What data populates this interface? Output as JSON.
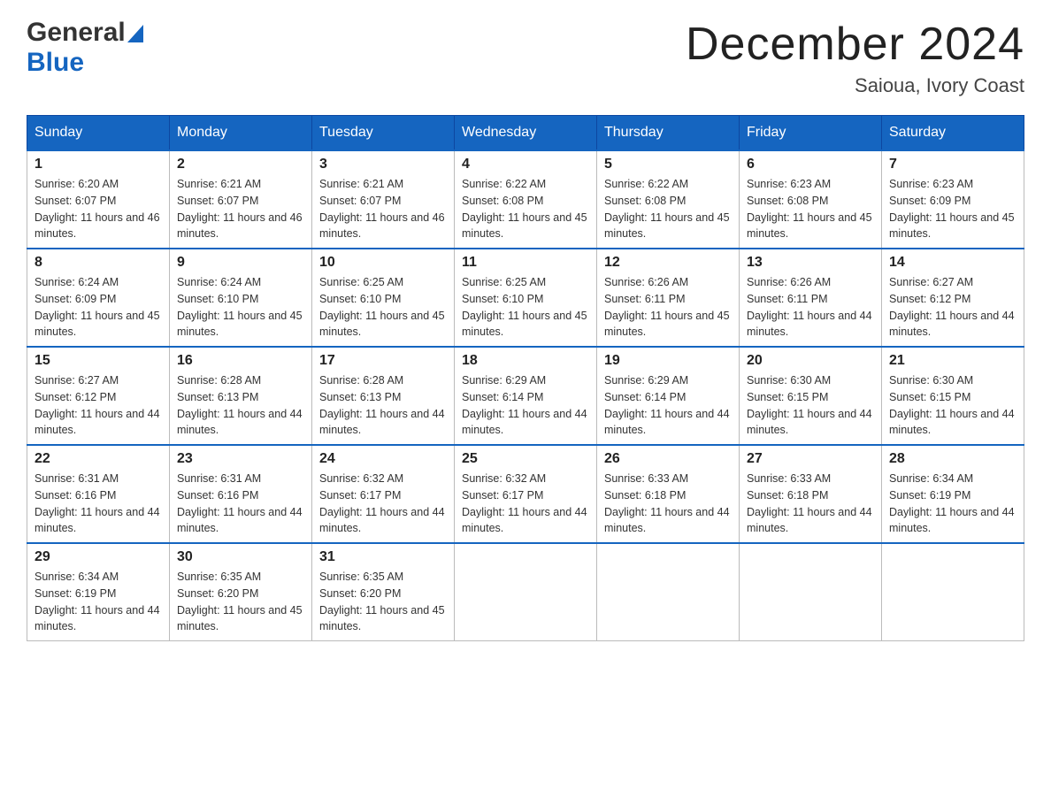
{
  "header": {
    "logo_general": "General",
    "logo_blue": "Blue",
    "month_title": "December 2024",
    "location": "Saioua, Ivory Coast"
  },
  "days_of_week": [
    "Sunday",
    "Monday",
    "Tuesday",
    "Wednesday",
    "Thursday",
    "Friday",
    "Saturday"
  ],
  "weeks": [
    [
      {
        "day": "1",
        "sunrise": "Sunrise: 6:20 AM",
        "sunset": "Sunset: 6:07 PM",
        "daylight": "Daylight: 11 hours and 46 minutes."
      },
      {
        "day": "2",
        "sunrise": "Sunrise: 6:21 AM",
        "sunset": "Sunset: 6:07 PM",
        "daylight": "Daylight: 11 hours and 46 minutes."
      },
      {
        "day": "3",
        "sunrise": "Sunrise: 6:21 AM",
        "sunset": "Sunset: 6:07 PM",
        "daylight": "Daylight: 11 hours and 46 minutes."
      },
      {
        "day": "4",
        "sunrise": "Sunrise: 6:22 AM",
        "sunset": "Sunset: 6:08 PM",
        "daylight": "Daylight: 11 hours and 45 minutes."
      },
      {
        "day": "5",
        "sunrise": "Sunrise: 6:22 AM",
        "sunset": "Sunset: 6:08 PM",
        "daylight": "Daylight: 11 hours and 45 minutes."
      },
      {
        "day": "6",
        "sunrise": "Sunrise: 6:23 AM",
        "sunset": "Sunset: 6:08 PM",
        "daylight": "Daylight: 11 hours and 45 minutes."
      },
      {
        "day": "7",
        "sunrise": "Sunrise: 6:23 AM",
        "sunset": "Sunset: 6:09 PM",
        "daylight": "Daylight: 11 hours and 45 minutes."
      }
    ],
    [
      {
        "day": "8",
        "sunrise": "Sunrise: 6:24 AM",
        "sunset": "Sunset: 6:09 PM",
        "daylight": "Daylight: 11 hours and 45 minutes."
      },
      {
        "day": "9",
        "sunrise": "Sunrise: 6:24 AM",
        "sunset": "Sunset: 6:10 PM",
        "daylight": "Daylight: 11 hours and 45 minutes."
      },
      {
        "day": "10",
        "sunrise": "Sunrise: 6:25 AM",
        "sunset": "Sunset: 6:10 PM",
        "daylight": "Daylight: 11 hours and 45 minutes."
      },
      {
        "day": "11",
        "sunrise": "Sunrise: 6:25 AM",
        "sunset": "Sunset: 6:10 PM",
        "daylight": "Daylight: 11 hours and 45 minutes."
      },
      {
        "day": "12",
        "sunrise": "Sunrise: 6:26 AM",
        "sunset": "Sunset: 6:11 PM",
        "daylight": "Daylight: 11 hours and 45 minutes."
      },
      {
        "day": "13",
        "sunrise": "Sunrise: 6:26 AM",
        "sunset": "Sunset: 6:11 PM",
        "daylight": "Daylight: 11 hours and 44 minutes."
      },
      {
        "day": "14",
        "sunrise": "Sunrise: 6:27 AM",
        "sunset": "Sunset: 6:12 PM",
        "daylight": "Daylight: 11 hours and 44 minutes."
      }
    ],
    [
      {
        "day": "15",
        "sunrise": "Sunrise: 6:27 AM",
        "sunset": "Sunset: 6:12 PM",
        "daylight": "Daylight: 11 hours and 44 minutes."
      },
      {
        "day": "16",
        "sunrise": "Sunrise: 6:28 AM",
        "sunset": "Sunset: 6:13 PM",
        "daylight": "Daylight: 11 hours and 44 minutes."
      },
      {
        "day": "17",
        "sunrise": "Sunrise: 6:28 AM",
        "sunset": "Sunset: 6:13 PM",
        "daylight": "Daylight: 11 hours and 44 minutes."
      },
      {
        "day": "18",
        "sunrise": "Sunrise: 6:29 AM",
        "sunset": "Sunset: 6:14 PM",
        "daylight": "Daylight: 11 hours and 44 minutes."
      },
      {
        "day": "19",
        "sunrise": "Sunrise: 6:29 AM",
        "sunset": "Sunset: 6:14 PM",
        "daylight": "Daylight: 11 hours and 44 minutes."
      },
      {
        "day": "20",
        "sunrise": "Sunrise: 6:30 AM",
        "sunset": "Sunset: 6:15 PM",
        "daylight": "Daylight: 11 hours and 44 minutes."
      },
      {
        "day": "21",
        "sunrise": "Sunrise: 6:30 AM",
        "sunset": "Sunset: 6:15 PM",
        "daylight": "Daylight: 11 hours and 44 minutes."
      }
    ],
    [
      {
        "day": "22",
        "sunrise": "Sunrise: 6:31 AM",
        "sunset": "Sunset: 6:16 PM",
        "daylight": "Daylight: 11 hours and 44 minutes."
      },
      {
        "day": "23",
        "sunrise": "Sunrise: 6:31 AM",
        "sunset": "Sunset: 6:16 PM",
        "daylight": "Daylight: 11 hours and 44 minutes."
      },
      {
        "day": "24",
        "sunrise": "Sunrise: 6:32 AM",
        "sunset": "Sunset: 6:17 PM",
        "daylight": "Daylight: 11 hours and 44 minutes."
      },
      {
        "day": "25",
        "sunrise": "Sunrise: 6:32 AM",
        "sunset": "Sunset: 6:17 PM",
        "daylight": "Daylight: 11 hours and 44 minutes."
      },
      {
        "day": "26",
        "sunrise": "Sunrise: 6:33 AM",
        "sunset": "Sunset: 6:18 PM",
        "daylight": "Daylight: 11 hours and 44 minutes."
      },
      {
        "day": "27",
        "sunrise": "Sunrise: 6:33 AM",
        "sunset": "Sunset: 6:18 PM",
        "daylight": "Daylight: 11 hours and 44 minutes."
      },
      {
        "day": "28",
        "sunrise": "Sunrise: 6:34 AM",
        "sunset": "Sunset: 6:19 PM",
        "daylight": "Daylight: 11 hours and 44 minutes."
      }
    ],
    [
      {
        "day": "29",
        "sunrise": "Sunrise: 6:34 AM",
        "sunset": "Sunset: 6:19 PM",
        "daylight": "Daylight: 11 hours and 44 minutes."
      },
      {
        "day": "30",
        "sunrise": "Sunrise: 6:35 AM",
        "sunset": "Sunset: 6:20 PM",
        "daylight": "Daylight: 11 hours and 45 minutes."
      },
      {
        "day": "31",
        "sunrise": "Sunrise: 6:35 AM",
        "sunset": "Sunset: 6:20 PM",
        "daylight": "Daylight: 11 hours and 45 minutes."
      },
      null,
      null,
      null,
      null
    ]
  ]
}
